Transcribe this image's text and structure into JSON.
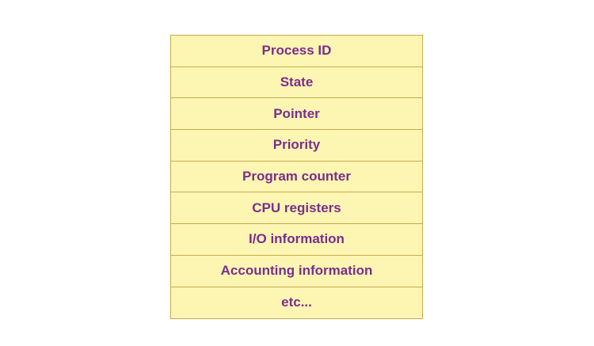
{
  "colors": {
    "cell_fill": "#fdf6b2",
    "cell_border": "#c9a94a",
    "text": "#7b2d8b"
  },
  "rows": [
    {
      "label": "Process ID"
    },
    {
      "label": "State"
    },
    {
      "label": "Pointer"
    },
    {
      "label": "Priority"
    },
    {
      "label": "Program counter"
    },
    {
      "label": "CPU registers"
    },
    {
      "label": "I/O information"
    },
    {
      "label": "Accounting information"
    },
    {
      "label": "etc..."
    }
  ]
}
